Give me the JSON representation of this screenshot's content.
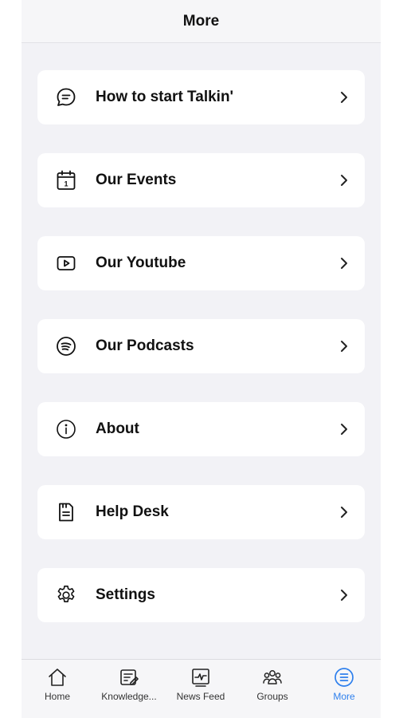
{
  "header": {
    "title": "More"
  },
  "menu": {
    "items": [
      {
        "label": "How to start Talkin'",
        "icon": "chat-icon"
      },
      {
        "label": "Our Events",
        "icon": "calendar-icon"
      },
      {
        "label": "Our Youtube",
        "icon": "youtube-icon"
      },
      {
        "label": "Our Podcasts",
        "icon": "spotify-icon"
      },
      {
        "label": "About",
        "icon": "info-icon"
      },
      {
        "label": "Help Desk",
        "icon": "document-icon"
      },
      {
        "label": "Settings",
        "icon": "gear-icon"
      }
    ],
    "calendar_day": "1"
  },
  "tabbar": {
    "tabs": [
      {
        "label": "Home",
        "icon": "home-icon",
        "active": false
      },
      {
        "label": "Knowledge...",
        "icon": "knowledge-icon",
        "active": false
      },
      {
        "label": "News Feed",
        "icon": "news-feed-icon",
        "active": false
      },
      {
        "label": "Groups",
        "icon": "groups-icon",
        "active": false
      },
      {
        "label": "More",
        "icon": "more-list-icon",
        "active": true
      }
    ]
  },
  "colors": {
    "background": "#f2f2f6",
    "card": "#ffffff",
    "accent": "#2f80ed",
    "text": "#111111"
  }
}
